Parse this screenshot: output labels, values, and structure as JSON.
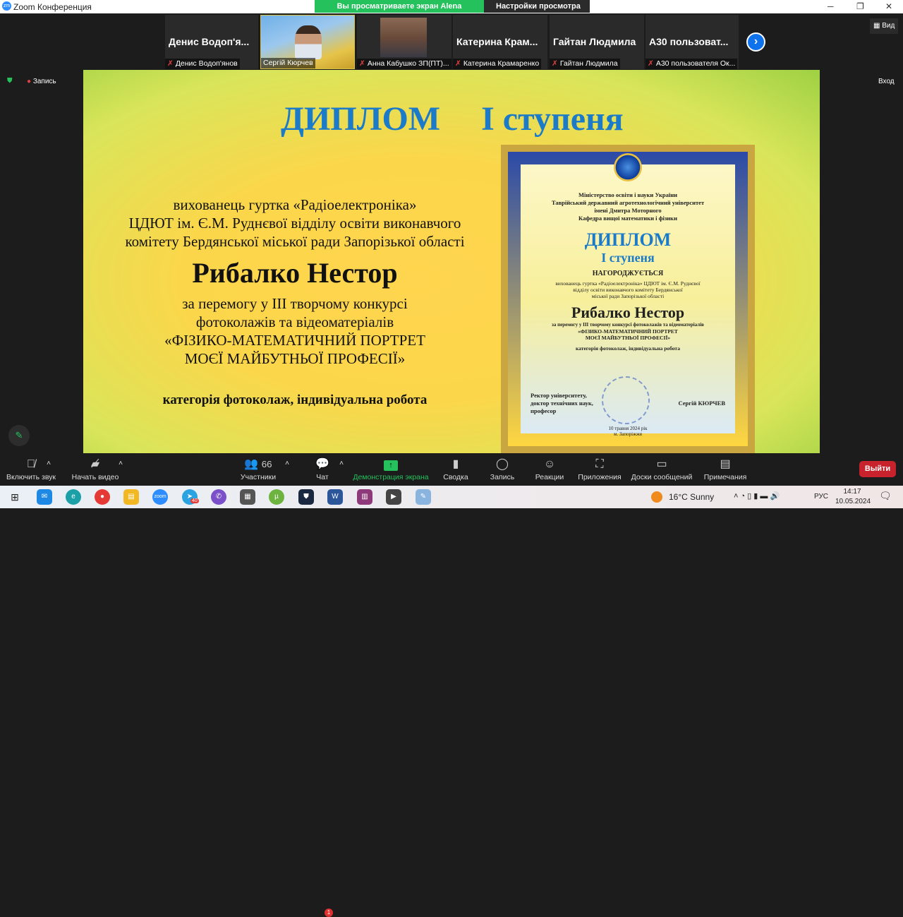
{
  "window": {
    "title": "Zoom Конференция",
    "logo": "zm"
  },
  "banner": {
    "text": "Вы просматриваете экран Alena Dyadenchuk",
    "view_settings": "Настройки просмотра"
  },
  "participants": [
    {
      "big": "Денис Водоп'я...",
      "name": "Денис Водоп'янов",
      "muted": true
    },
    {
      "big": "",
      "name": "Сергій Кюрчев",
      "muted": false,
      "video": true
    },
    {
      "big": "",
      "name": "Анна Кабушко ЗП(ПТ)...",
      "muted": true,
      "video": true
    },
    {
      "big": "Катерина  Крам...",
      "name": "Катерина Крамаренко",
      "muted": true
    },
    {
      "big": "Гайтан Людмила",
      "name": "Гайтан Людмила",
      "muted": true
    },
    {
      "big": "А30 пользоват...",
      "name": "А30 пользователя Ок...",
      "muted": true
    }
  ],
  "view_button": "Вид",
  "recording": "Запись",
  "exit_fullscreen": "Вход",
  "slide": {
    "title1": "ДИПЛОМ",
    "title2": "I ступеня",
    "line1": "вихованець гуртка «Радіоелектроніка»",
    "line2": "ЦДЮТ ім. Є.М. Руднєвої відділу освіти виконавчого",
    "line3": "комітету Бердянської міської ради Запорізької області",
    "name": "Рибалко Нестор",
    "line4": "за перемогу у ІІІ творчому конкурсі",
    "line5": "фотоколажів та відеоматеріалів",
    "line6": "«ФІЗИКО-МАТЕМАТИЧНИЙ ПОРТРЕТ",
    "line7": "МОЄЇ МАЙБУТНЬОЇ ПРОФЕСІЇ»",
    "line8": "категорія фотоколаж, індивідуальна робота"
  },
  "diploma": {
    "h1": "Міністерство освіти і науки України",
    "h2": "Таврійський державний агротехнологічний університет",
    "h3": "імені Дмитра Моторного",
    "h4": "Кафедра вищої математики і фізики",
    "title1": "ДИПЛОМ",
    "title2": "I ступеня",
    "awarded": "НАГОРОДЖУЄТЬСЯ",
    "p1": "вихованець гуртка «Радіоелектроніка» ЦДЮТ ім. Є.М. Руднєвої",
    "p2": "відділу освіти виконавчого комітету Бердянської",
    "p3": "міської ради Запорізької області",
    "name": "Рибалко Нестор",
    "p4": "за перемогу у ІІІ творчому конкурсі фотоколажів та відеоматеріалів",
    "p5": "«ФІЗИКО-МАТЕМАТИЧНИЙ ПОРТРЕТ",
    "p6": "МОЄЇ МАЙБУТНЬОЇ ПРОФЕСІЇ»",
    "p7": "категорія фотоколаж, індивідуальна робота",
    "sign1": "Ректор університету,",
    "sign2": "доктор технічних наук,",
    "sign3": "професор",
    "signer": "Сергій КЮРЧЕВ",
    "date": "10 травня 2024 рік",
    "city": "м. Запоріжжя"
  },
  "toolbar": {
    "unmute": "Включить звук",
    "video": "Начать видео",
    "participants": "Участники",
    "participants_count": "66",
    "chat": "Чат",
    "chat_badge": "1",
    "share": "Демонстрация экрана",
    "summary": "Сводка",
    "record": "Запись",
    "reactions": "Реакции",
    "apps": "Приложения",
    "whiteboards": "Доски сообщений",
    "notes": "Примечания",
    "leave": "Выйти"
  },
  "taskbar": {
    "weather": "16°C  Sunny",
    "lang": "РУС",
    "time": "14:17",
    "date": "10.05.2024",
    "telegram_badge": "40"
  },
  "colors": {
    "accent": "#0e72ed",
    "leave": "#c8232c",
    "share_green": "#24c15c",
    "diploma_blue": "#1b7bc9"
  }
}
